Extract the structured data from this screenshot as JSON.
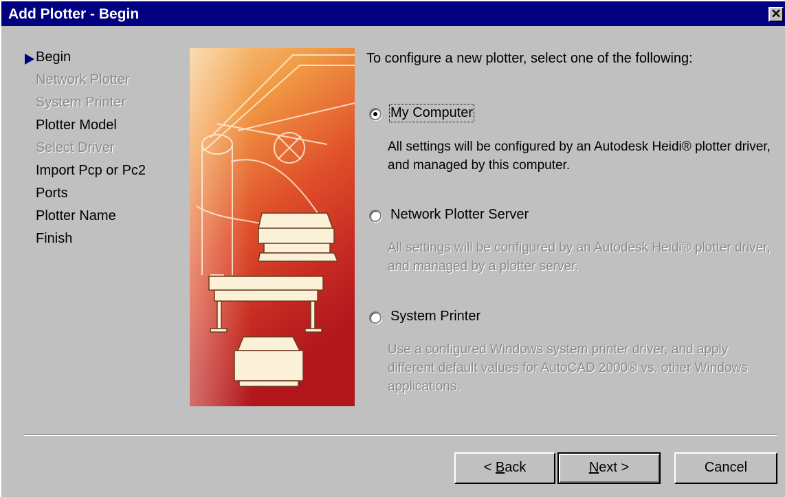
{
  "window": {
    "title": "Add Plotter - Begin",
    "close_glyph": "✕"
  },
  "steps": [
    {
      "label": "Begin",
      "state": "current"
    },
    {
      "label": "Network Plotter",
      "state": "disabled"
    },
    {
      "label": "System Printer",
      "state": "disabled"
    },
    {
      "label": "Plotter Model",
      "state": "enabled"
    },
    {
      "label": "Select Driver",
      "state": "disabled"
    },
    {
      "label": "Import Pcp or Pc2",
      "state": "enabled"
    },
    {
      "label": "Ports",
      "state": "enabled"
    },
    {
      "label": "Plotter Name",
      "state": "enabled"
    },
    {
      "label": "Finish",
      "state": "enabled"
    }
  ],
  "content": {
    "heading": "To configure a new plotter, select one of the following:",
    "options": [
      {
        "label_pre": "",
        "label_key": "M",
        "label_post": "y Computer",
        "selected": true,
        "description": "All settings will be configured by an Autodesk Heidi® plotter driver, and managed by this computer.",
        "description_enabled": true
      },
      {
        "label_pre": "",
        "label_key": "N",
        "label_post": "etwork Plotter Server",
        "selected": false,
        "description": "All settings will be configured by an Autodesk Heidi® plotter driver, and managed by a plotter server.",
        "description_enabled": false
      },
      {
        "label_pre": "",
        "label_key": "S",
        "label_post": "ystem Printer",
        "selected": false,
        "description": "Use a configured Windows system printer driver, and apply different default values for AutoCAD 2000® vs. other Windows applications.",
        "description_enabled": false
      }
    ]
  },
  "buttons": {
    "back": {
      "pre": "< ",
      "key": "B",
      "post": "ack"
    },
    "next": {
      "pre": "",
      "key": "N",
      "post": "ext >"
    },
    "cancel": {
      "label": "Cancel"
    }
  },
  "colors": {
    "titlebar": "#000080",
    "face": "#c0c0c0",
    "disabled_text": "#8a8a8a"
  },
  "icons": {
    "current_step": "arrow-right-icon",
    "illustration": "plotter-illustration"
  }
}
